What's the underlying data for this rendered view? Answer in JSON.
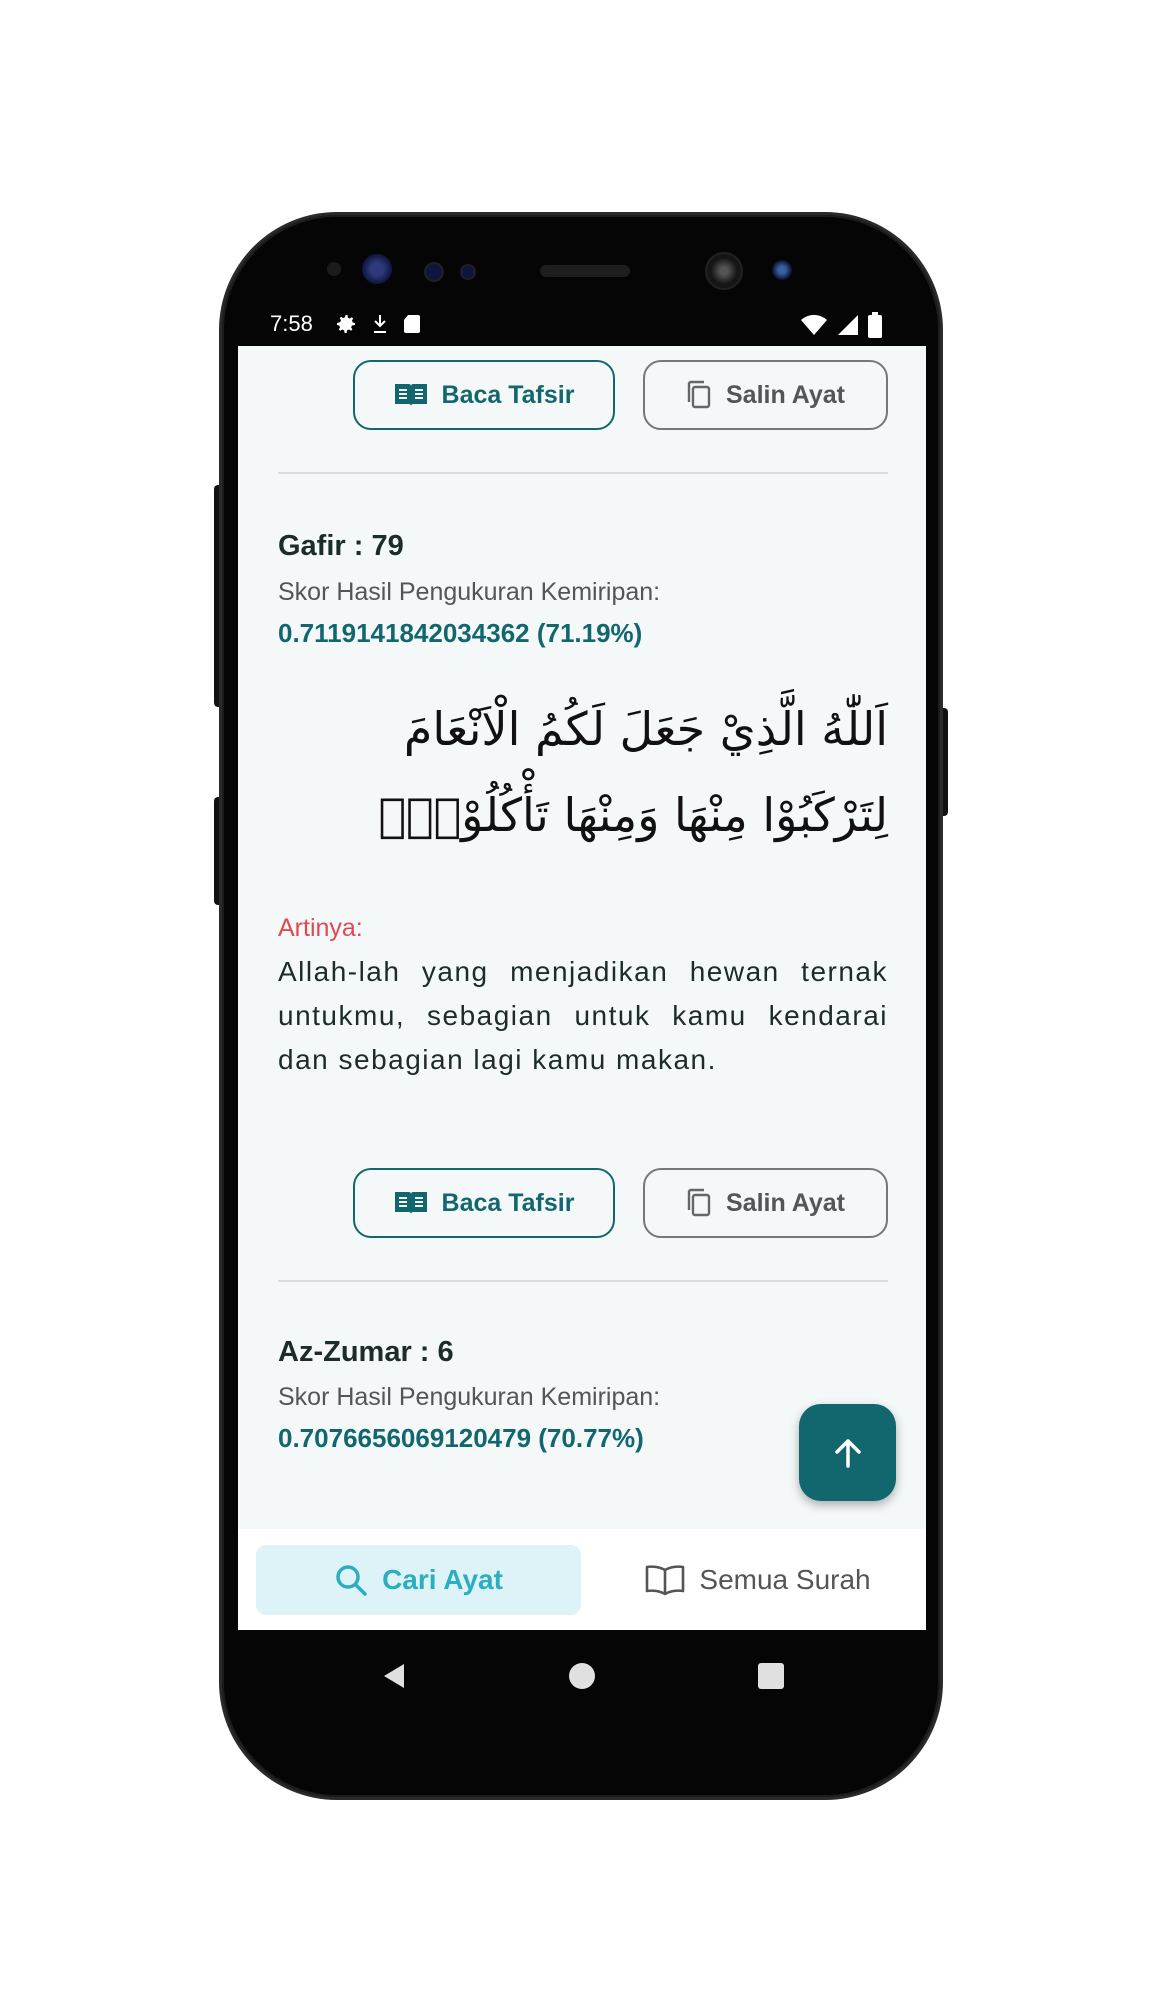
{
  "status_bar": {
    "time": "7:58",
    "left_icons": [
      "gear-icon",
      "download-icon",
      "sd-card-icon"
    ],
    "right_icons": [
      "wifi-icon",
      "signal-icon",
      "battery-icon"
    ]
  },
  "top_actions": {
    "tafsir_label": "Baca Tafsir",
    "salin_label": "Salin Ayat"
  },
  "results": [
    {
      "heading": "Gafir : 79",
      "score_label": "Skor Hasil Pengukuran Kemiripan:",
      "score_value": "0.7119141842034362 (71.19%)",
      "arabic": "اَللّٰهُ الَّذِيْ جَعَلَ لَكُمُ الْاَنْعَامَ لِتَرْكَبُوْا مِنْهَا وَمِنْهَا تَأْكُلُوْنَۖ",
      "translation_label": "Artinya:",
      "translation": "Allah-lah yang menjadikan hewan ternak untukmu, sebagian untuk kamu kendarai dan sebagian lagi kamu makan.",
      "tafsir_label": "Baca Tafsir",
      "salin_label": "Salin Ayat"
    },
    {
      "heading": "Az-Zumar : 6",
      "score_label": "Skor Hasil Pengukuran Kemiripan:",
      "score_value": "0.7076656069120479 (70.77%)"
    }
  ],
  "fab": {
    "icon": "arrow-up-icon"
  },
  "bottom_nav": {
    "items": [
      {
        "label": "Cari Ayat",
        "icon": "search-icon",
        "active": true
      },
      {
        "label": "Semua Surah",
        "icon": "book-open-icon",
        "active": false
      }
    ]
  },
  "colors": {
    "primary": "#12676f",
    "accent_active": "#2baec0",
    "active_bg": "#def3f7",
    "artinya": "#e0494f",
    "screen_bg": "#f4f8f8"
  }
}
